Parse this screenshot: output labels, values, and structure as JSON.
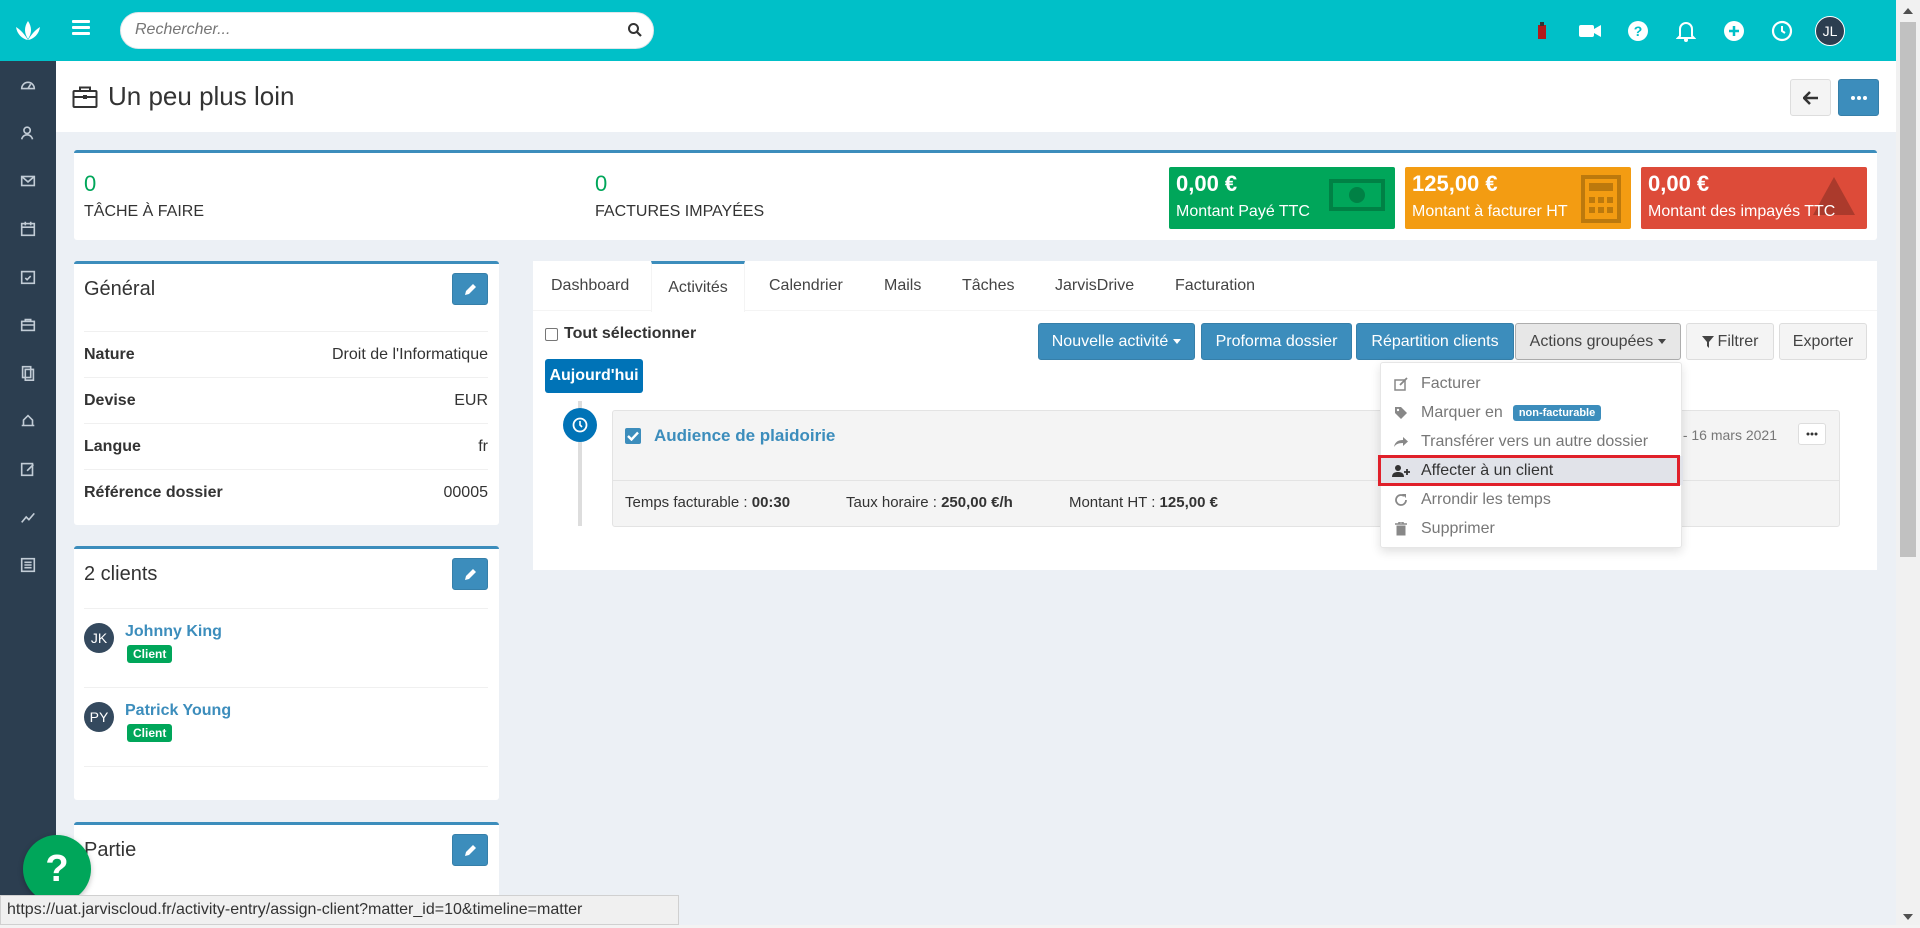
{
  "search": {
    "placeholder": "Rechercher..."
  },
  "user": {
    "initials": "JL"
  },
  "page": {
    "title": "Un peu plus loin"
  },
  "stats": {
    "tasks": {
      "value": "0",
      "label": "TÂCHE À FAIRE"
    },
    "invoices": {
      "value": "0",
      "label": "FACTURES IMPAYÉES"
    },
    "paid": {
      "amount": "0,00 €",
      "label": "Montant Payé TTC",
      "color": "#00a65a"
    },
    "to_invoice": {
      "amount": "125,00 €",
      "label": "Montant à facturer HT",
      "color": "#f39c12"
    },
    "unpaid": {
      "amount": "0,00 €",
      "label": "Montant des impayés TTC",
      "color": "#dd4b39"
    }
  },
  "general": {
    "title": "Général",
    "rows": [
      {
        "key": "Nature",
        "value": "Droit de l'Informatique"
      },
      {
        "key": "Devise",
        "value": "EUR"
      },
      {
        "key": "Langue",
        "value": "fr"
      },
      {
        "key": "Référence dossier",
        "value": "00005"
      }
    ]
  },
  "clients": {
    "title": "2 clients",
    "items": [
      {
        "initials": "JK",
        "name": "Johnny King",
        "badge": "Client"
      },
      {
        "initials": "PY",
        "name": "Patrick Young",
        "badge": "Client"
      }
    ]
  },
  "partie": {
    "title": "Partie"
  },
  "help": {
    "label": "?"
  },
  "tabs": [
    "Dashboard",
    "Activités",
    "Calendrier",
    "Mails",
    "Tâches",
    "JarvisDrive",
    "Facturation"
  ],
  "active_tab": "Activités",
  "toolbar": {
    "select_all": "Tout sélectionner",
    "new_activity": "Nouvelle activité",
    "proforma": "Proforma dossier",
    "repartition": "Répartition clients",
    "grouped_actions": "Actions groupées",
    "filter": "Filtrer",
    "export": "Exporter"
  },
  "today": "Aujourd'hui",
  "activity": {
    "title": "Audience de plaidoirie",
    "date": "- 16 mars 2021",
    "billable_label": "Temps facturable : ",
    "billable_value": "00:30",
    "rate_label": "Taux horaire : ",
    "rate_value": "250,00 €/h",
    "amount_label": "Montant HT : ",
    "amount_value": "125,00 €"
  },
  "dropdown": {
    "invoice": "Facturer",
    "mark_as": "Marquer en",
    "mark_badge": "non-facturable",
    "transfer": "Transférer vers un autre dossier",
    "assign_client": "Affecter à un client",
    "round_times": "Arrondir les temps",
    "delete": "Supprimer"
  },
  "statusbar": {
    "url": "https://uat.jarviscloud.fr/activity-entry/assign-client?matter_id=10&timeline=matter"
  },
  "colors": {
    "accent": "#00c0c8",
    "primary": "#3c8dbc",
    "sidebar": "#2c3e50",
    "highlight_frame": "#e0202a"
  }
}
